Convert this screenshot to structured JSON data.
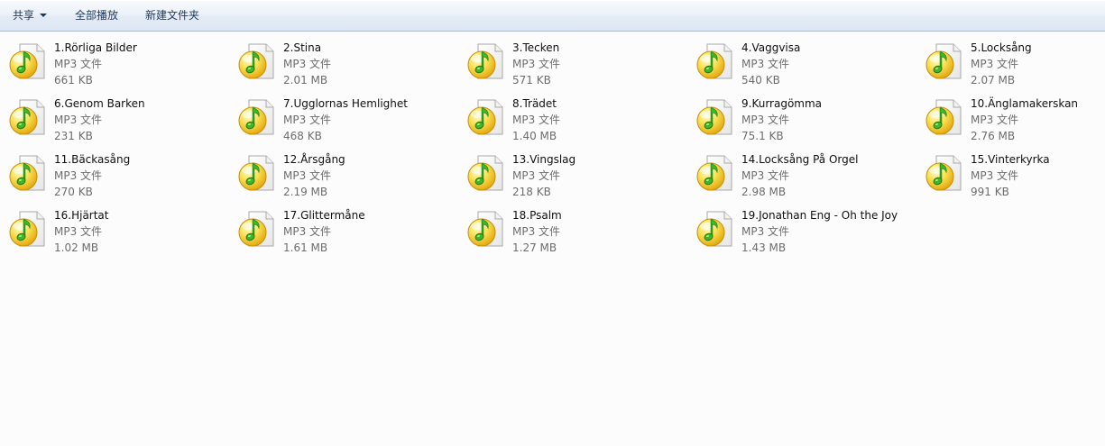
{
  "toolbar": {
    "share_label": "共享",
    "play_all_label": "全部播放",
    "new_folder_label": "新建文件夹"
  },
  "files": [
    {
      "name": "1.Rörliga Bilder",
      "type": "MP3 文件",
      "size": "661 KB",
      "icon": "mp3-file-icon"
    },
    {
      "name": "2.Stina",
      "type": "MP3 文件",
      "size": "2.01 MB",
      "icon": "mp3-file-icon"
    },
    {
      "name": "3.Tecken",
      "type": "MP3 文件",
      "size": "571 KB",
      "icon": "mp3-file-icon"
    },
    {
      "name": "4.Vaggvisa",
      "type": "MP3 文件",
      "size": "540 KB",
      "icon": "mp3-file-icon"
    },
    {
      "name": "5.Locksång",
      "type": "MP3 文件",
      "size": "2.07 MB",
      "icon": "mp3-file-icon"
    },
    {
      "name": "6.Genom Barken",
      "type": "MP3 文件",
      "size": "231 KB",
      "icon": "mp3-file-icon"
    },
    {
      "name": "7.Ugglornas Hemlighet",
      "type": "MP3 文件",
      "size": "468 KB",
      "icon": "mp3-file-icon"
    },
    {
      "name": "8.Trädet",
      "type": "MP3 文件",
      "size": "1.40 MB",
      "icon": "mp3-file-icon"
    },
    {
      "name": "9.Kurragömma",
      "type": "MP3 文件",
      "size": "75.1 KB",
      "icon": "mp3-file-icon"
    },
    {
      "name": "10.Änglamakerskan",
      "type": "MP3 文件",
      "size": "2.76 MB",
      "icon": "mp3-file-icon"
    },
    {
      "name": "11.Bäckasång",
      "type": "MP3 文件",
      "size": "270 KB",
      "icon": "mp3-file-icon"
    },
    {
      "name": "12.Årsgång",
      "type": "MP3 文件",
      "size": "2.19 MB",
      "icon": "mp3-file-icon"
    },
    {
      "name": "13.Vingslag",
      "type": "MP3 文件",
      "size": "218 KB",
      "icon": "mp3-file-icon"
    },
    {
      "name": "14.Locksång På Orgel",
      "type": "MP3 文件",
      "size": "2.98 MB",
      "icon": "mp3-file-icon"
    },
    {
      "name": "15.Vinterkyrka",
      "type": "MP3 文件",
      "size": "991 KB",
      "icon": "mp3-file-icon"
    },
    {
      "name": "16.Hjärtat",
      "type": "MP3 文件",
      "size": "1.02 MB",
      "icon": "mp3-file-icon"
    },
    {
      "name": "17.Glittermåne",
      "type": "MP3 文件",
      "size": "1.61 MB",
      "icon": "mp3-file-icon"
    },
    {
      "name": "18.Psalm",
      "type": "MP3 文件",
      "size": "1.27 MB",
      "icon": "mp3-file-icon"
    },
    {
      "name": "19.Jonathan Eng - Oh the Joy",
      "type": "MP3 文件",
      "size": "1.43 MB",
      "icon": "mp3-file-icon"
    }
  ]
}
